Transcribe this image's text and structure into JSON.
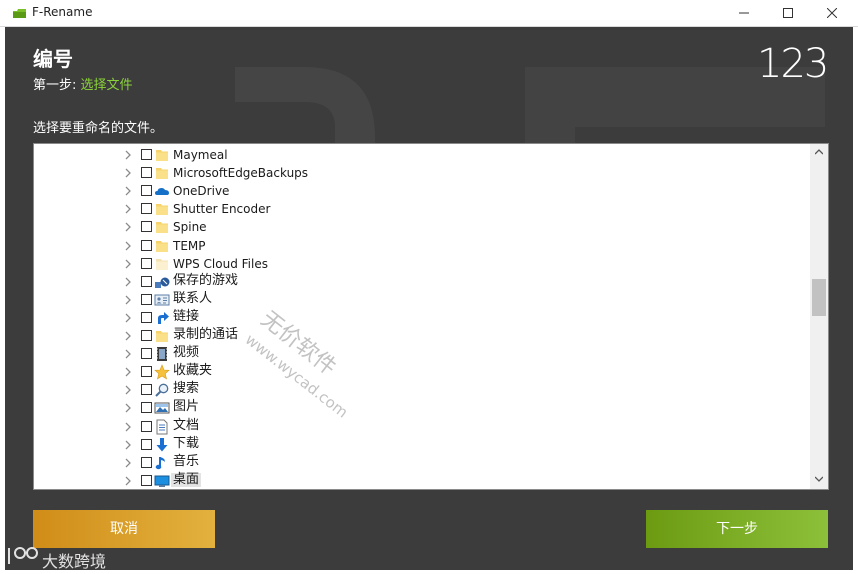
{
  "window": {
    "title": "F-Rename",
    "controls": [
      "minimize",
      "maximize",
      "close"
    ]
  },
  "header": {
    "title": "编号",
    "step_prefix": "第一步: ",
    "step_name": "选择文件",
    "logo_text": "123",
    "instruction": "选择要重命名的文件。"
  },
  "tree": {
    "items": [
      {
        "label": "Maymeal",
        "icon": "folder-icon",
        "checked": false
      },
      {
        "label": "MicrosoftEdgeBackups",
        "icon": "folder-icon",
        "checked": false
      },
      {
        "label": "OneDrive",
        "icon": "onedrive-cloud-icon",
        "checked": false
      },
      {
        "label": "Shutter Encoder",
        "icon": "folder-icon",
        "checked": false
      },
      {
        "label": "Spine",
        "icon": "folder-icon",
        "checked": false
      },
      {
        "label": "TEMP",
        "icon": "folder-icon",
        "checked": false
      },
      {
        "label": "WPS Cloud Files",
        "icon": "folder-light-icon",
        "checked": false
      },
      {
        "label": "保存的游戏",
        "icon": "saved-games-icon",
        "checked": false
      },
      {
        "label": "联系人",
        "icon": "contacts-icon",
        "checked": false
      },
      {
        "label": "链接",
        "icon": "link-arrow-icon",
        "checked": false
      },
      {
        "label": "录制的通话",
        "icon": "folder-icon",
        "checked": false
      },
      {
        "label": "视频",
        "icon": "video-icon",
        "checked": false
      },
      {
        "label": "收藏夹",
        "icon": "star-icon",
        "checked": false
      },
      {
        "label": "搜索",
        "icon": "search-icon",
        "checked": false
      },
      {
        "label": "图片",
        "icon": "pictures-icon",
        "checked": false
      },
      {
        "label": "文档",
        "icon": "document-icon",
        "checked": false
      },
      {
        "label": "下载",
        "icon": "download-arrow-icon",
        "checked": false
      },
      {
        "label": "音乐",
        "icon": "music-note-icon",
        "checked": false
      },
      {
        "label": "桌面",
        "icon": "desktop-icon",
        "checked": false,
        "selected": true
      }
    ]
  },
  "buttons": {
    "cancel": "取消",
    "next": "下一步"
  },
  "watermarks": {
    "diagonal_text": "无价软件",
    "diagonal_url": "www.wycad.com",
    "bottom_text": "大数跨境"
  },
  "colors": {
    "background": "#3c3c3c",
    "step_accent": "#8bd23a",
    "cancel_button": "#d9a22e",
    "next_button": "#7aac24"
  }
}
